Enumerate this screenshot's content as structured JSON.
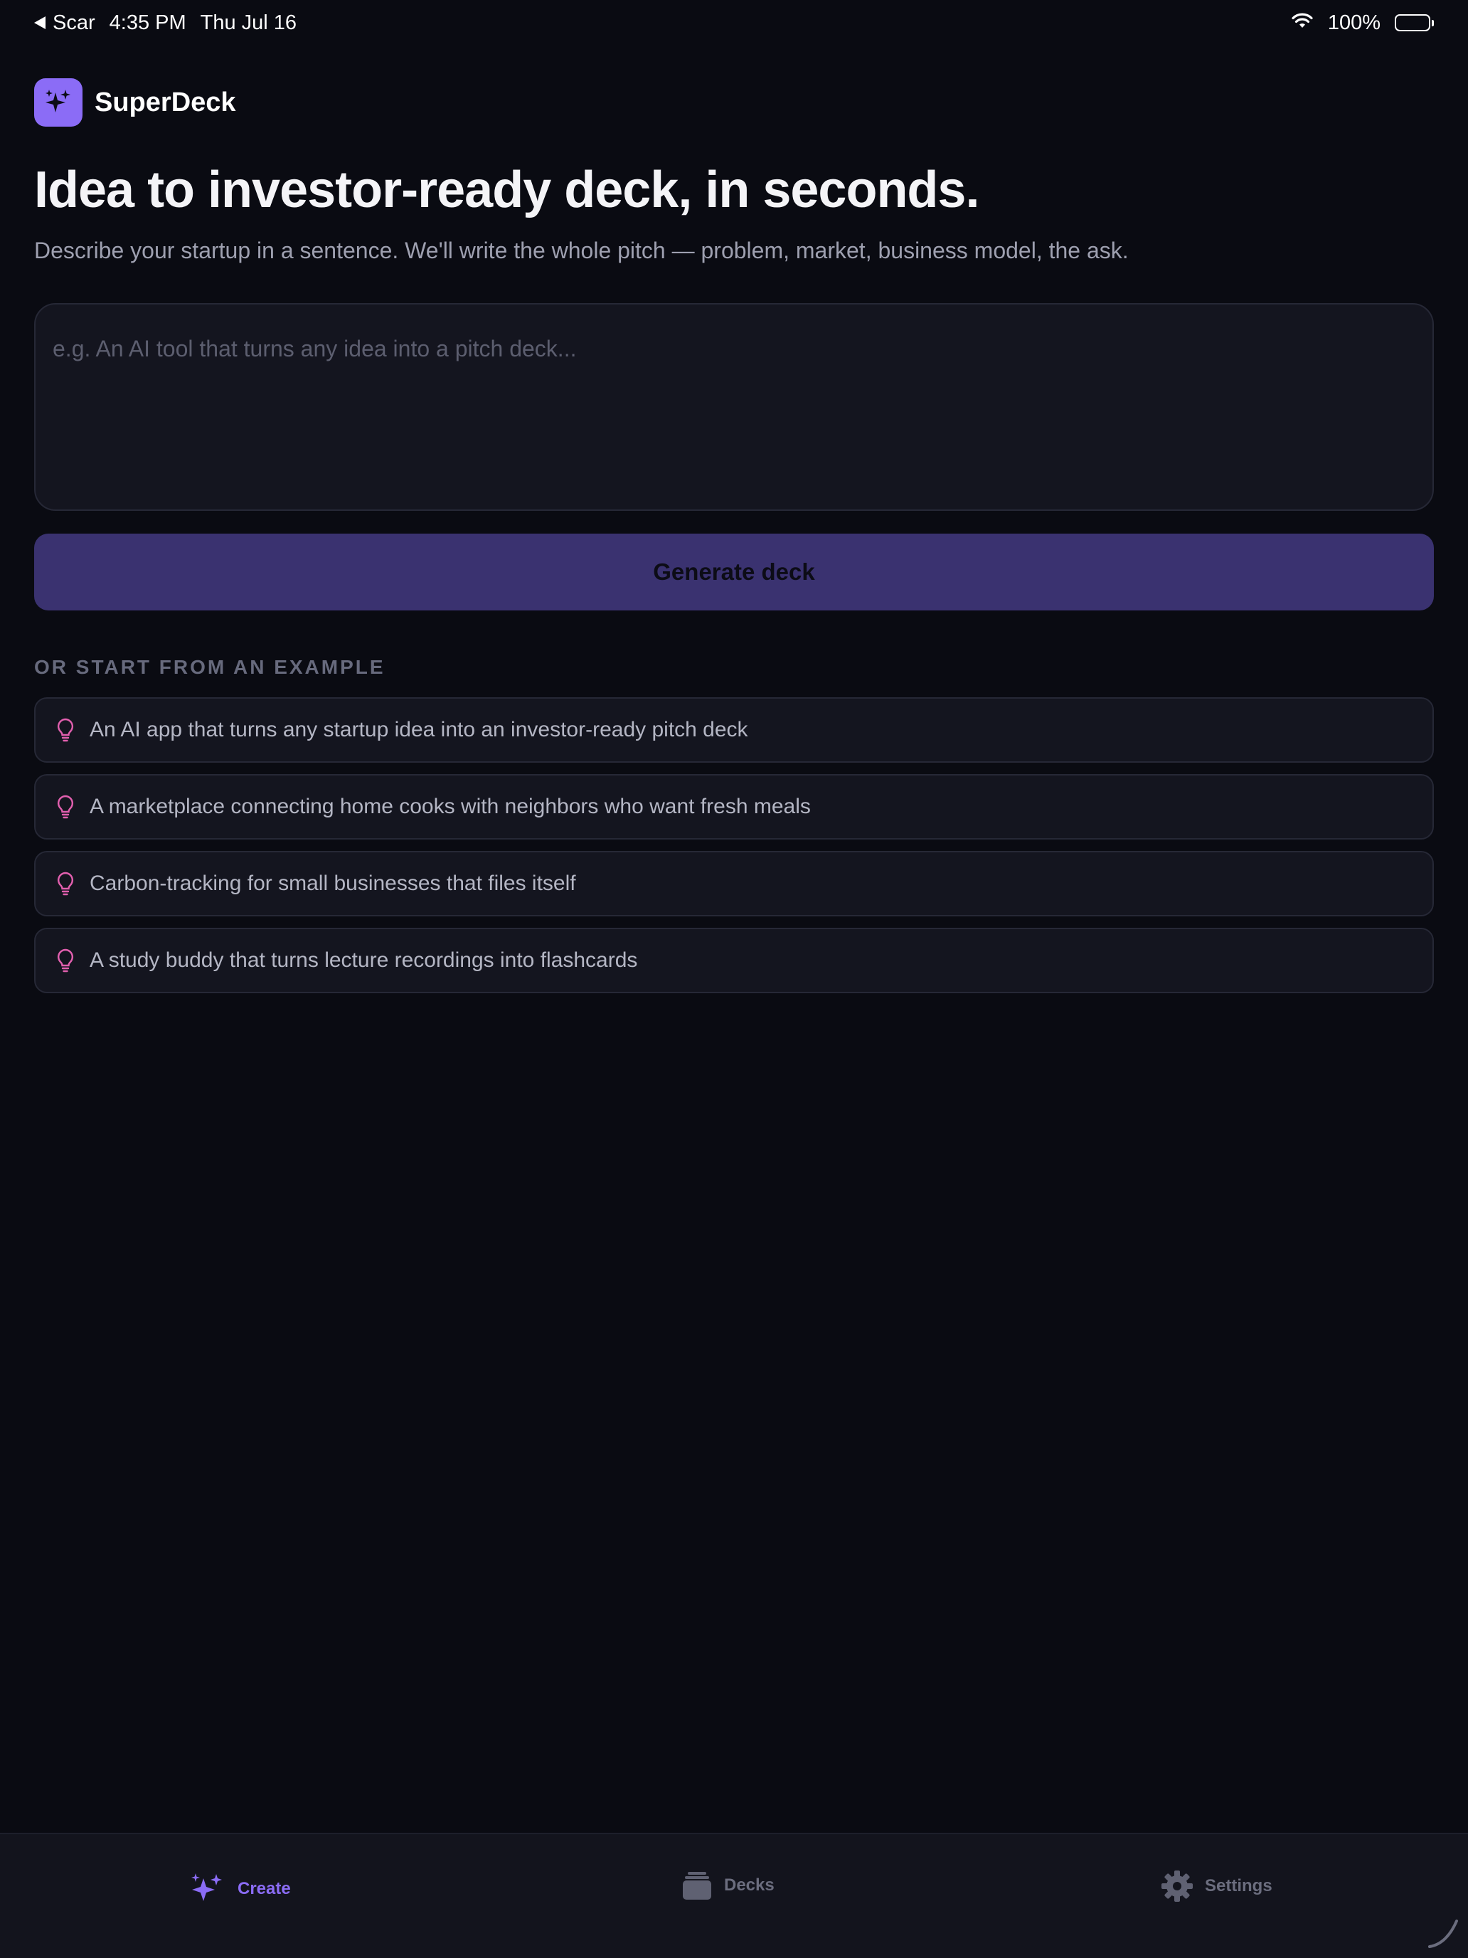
{
  "status_bar": {
    "back_app": "Scar",
    "time": "4:35 PM",
    "date": "Thu Jul 16",
    "battery": "100%",
    "wifi_icon": "wifi-icon",
    "battery_icon": "battery-icon"
  },
  "brand": {
    "name": "SuperDeck",
    "logo_icon": "sparkles-icon",
    "accent": "#8b6cf6"
  },
  "hero": {
    "title": "Idea to investor-ready deck, in seconds.",
    "subtitle": "Describe your startup in a sentence. We'll write the whole pitch — problem, market, business model, the ask."
  },
  "idea_input": {
    "value": "",
    "placeholder": "e.g. An AI tool that turns any idea into a pitch deck..."
  },
  "generate_button": {
    "label": "Generate deck",
    "color": "#3a3270"
  },
  "examples": {
    "heading": "OR START FROM AN EXAMPLE",
    "icon": "lightbulb-icon",
    "icon_color": "#e15fae",
    "items": [
      "An AI app that turns any startup idea into an investor-ready pitch deck",
      "A marketplace connecting home cooks with neighbors who want fresh meals",
      "Carbon-tracking for small businesses that files itself",
      "A study buddy that turns lecture recordings into flashcards"
    ]
  },
  "tab_bar": {
    "tabs": [
      {
        "label": "Create",
        "icon": "sparkles-icon",
        "active": true
      },
      {
        "label": "Decks",
        "icon": "stack-icon",
        "active": false
      },
      {
        "label": "Settings",
        "icon": "gear-icon",
        "active": false
      }
    ]
  }
}
